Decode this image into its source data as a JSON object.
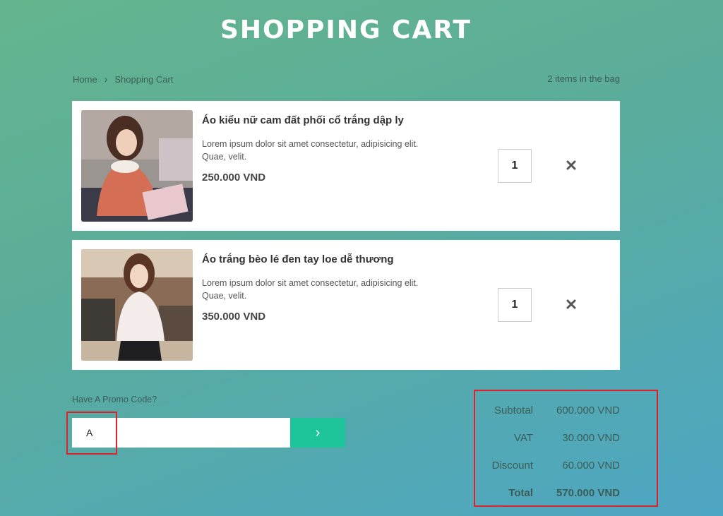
{
  "header": {
    "title": "Shopping Cart"
  },
  "breadcrumb": {
    "home": "Home",
    "current": "Shopping Cart"
  },
  "bag": {
    "count_text": "2 items in the bag"
  },
  "items": [
    {
      "name": "Áo kiểu nữ cam đất phối cổ trắng dập ly",
      "description": "Lorem ipsum dolor sit amet consectetur, adipisicing elit. Quae, velit.",
      "price": "250.000 VND",
      "quantity": "1"
    },
    {
      "name": "Áo trắng bèo lé đen tay loe dễ thương",
      "description": "Lorem ipsum dolor sit amet consectetur, adipisicing elit. Quae, velit.",
      "price": "350.000 VND",
      "quantity": "1"
    }
  ],
  "promo": {
    "label": "Have A Promo Code?",
    "value": "A",
    "submit_label": "›"
  },
  "summary": {
    "subtotal_label": "Subtotal",
    "subtotal_value": "600.000 VND",
    "vat_label": "VAT",
    "vat_value": "30.000 VND",
    "discount_label": "Discount",
    "discount_value": "60.000 VND",
    "total_label": "Total",
    "total_value": "570.000 VND"
  },
  "colors": {
    "accent": "#1fc59a",
    "annotation": "#e0202a"
  }
}
